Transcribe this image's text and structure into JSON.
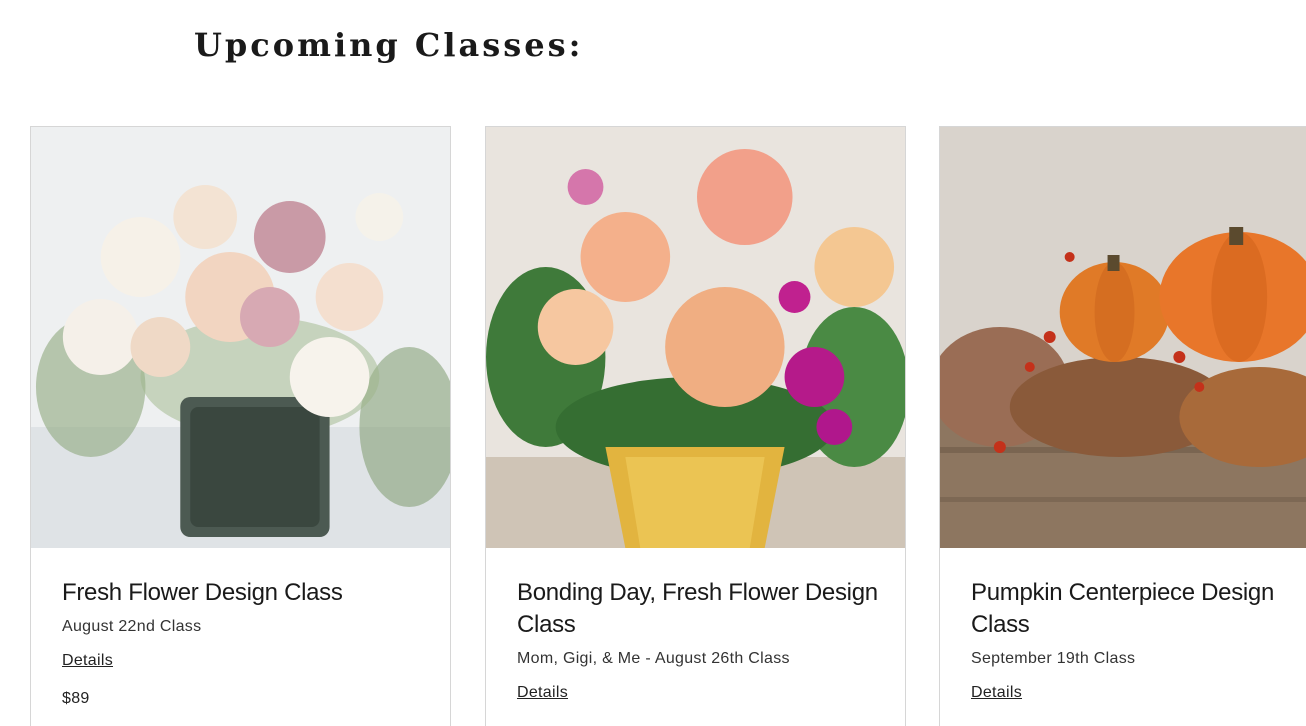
{
  "section": {
    "heading": "Upcoming Classes:"
  },
  "classes": [
    {
      "image_alt": "White and blush flower arrangement in glass vase",
      "title": "Fresh Flower Design Class",
      "subtitle": "August 22nd Class",
      "link_label": "Details",
      "price": "$89"
    },
    {
      "image_alt": "Peach roses and magenta flowers in gold vase",
      "title": "Bonding Day, Fresh Flower Design Class",
      "subtitle": "Mom, Gigi, & Me - August 26th Class",
      "link_label": "Details",
      "price": ""
    },
    {
      "image_alt": "Pumpkin centerpiece with autumn foliage",
      "title": "Pumpkin Centerpiece Design Class",
      "subtitle": "September 19th Class",
      "link_label": "Details",
      "price": ""
    }
  ]
}
